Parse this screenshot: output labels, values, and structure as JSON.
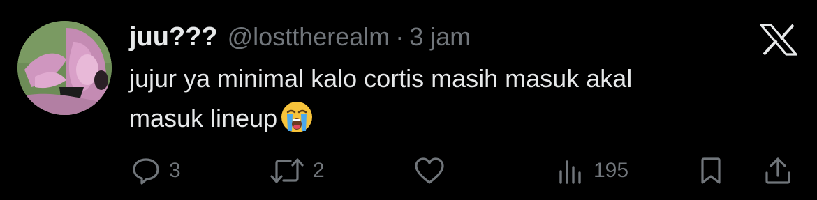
{
  "tweet": {
    "author": {
      "display_name": "juu???",
      "handle": "@losttherealm",
      "avatar_icon": "profile-photo"
    },
    "separator": "·",
    "time_ago": "3 jam",
    "text_lines": [
      "jujur ya minimal kalo cortis masih masuk akal",
      "masuk lineup"
    ],
    "emoji": "loudly-crying-face",
    "brand_icon": "x-logo-icon"
  },
  "actions": {
    "reply": {
      "icon": "reply-icon",
      "count": "3"
    },
    "repost": {
      "icon": "repost-icon",
      "count": "2"
    },
    "like": {
      "icon": "heart-icon",
      "count": ""
    },
    "views": {
      "icon": "views-icon",
      "count": "195"
    },
    "bookmark": {
      "icon": "bookmark-icon"
    },
    "share": {
      "icon": "share-icon"
    }
  },
  "colors": {
    "background": "#000000",
    "primary_text": "#e7e9ea",
    "secondary_text": "#71767b"
  }
}
